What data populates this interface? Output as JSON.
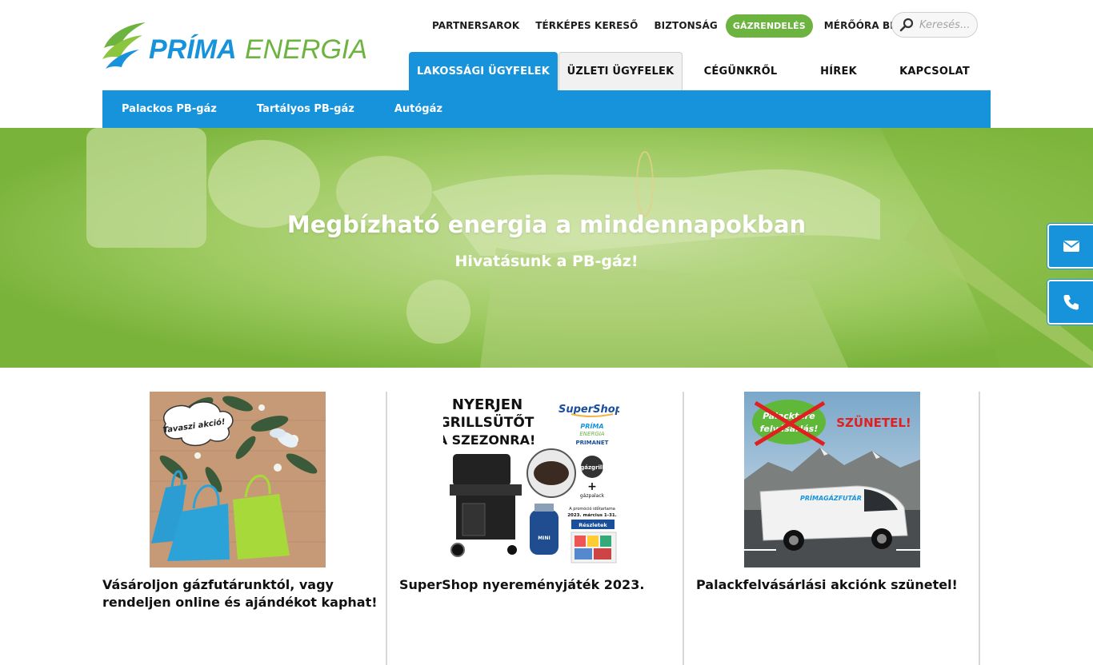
{
  "brand": {
    "logo_text_prima": "PRÍMA",
    "logo_text_energia": "ENERGIA",
    "green": "#6cb33f",
    "blue": "#1793dc"
  },
  "top_links": [
    {
      "label": "PARTNERSAROK"
    },
    {
      "label": "TÉRKÉPES KERESŐ"
    },
    {
      "label": "BIZTONSÁG"
    },
    {
      "label": "GÁZRENDELÉS"
    },
    {
      "label": "MÉRŐÓRA BEJELENTÉS"
    }
  ],
  "search": {
    "placeholder": "Keresés...",
    "icon": "search-icon"
  },
  "main_nav": [
    {
      "label": "LAKOSSÁGI ÜGYFELEK",
      "state": "active"
    },
    {
      "label": "ÜZLETI ÜGYFELEK",
      "state": "boxed"
    },
    {
      "label": "CÉGÜNKRŐL"
    },
    {
      "label": "HÍREK"
    },
    {
      "label": "KAPCSOLAT"
    }
  ],
  "sub_nav": [
    {
      "label": "Palackos PB-gáz"
    },
    {
      "label": "Tartályos PB-gáz"
    },
    {
      "label": "Autógáz"
    }
  ],
  "hero": {
    "title": "Megbízható energia a mindennapokban",
    "subtitle": "Hivatásunk a PB-gáz!"
  },
  "floating": {
    "mail_icon": "envelope-icon",
    "phone_icon": "phone-icon"
  },
  "cards": [
    {
      "caption": "Vásároljon gázfutárunktól, vagy rendeljen online és ajándékot kaphat!",
      "image_text": "Tavaszi akció!"
    },
    {
      "caption": "SuperShop nyereményjáték 2023.",
      "image_text": {
        "headline1": "NYERJEN",
        "headline2": "GRILLSÜTŐT",
        "headline3": "A SZEZONRA!",
        "supershop": "SuperShop",
        "prima": "PRÍMA",
        "energia": "ENERGIA",
        "primanet": "PRIMANET",
        "gazgrill": "gázgrill",
        "plus": "+",
        "gazpalack": "gázpalack",
        "promo": "A promóció időtartama",
        "dates": "2023. március 1-31.",
        "details": "Részletek"
      }
    },
    {
      "caption": "Palackfelvásárlási akciónk szünetel!",
      "image_text": {
        "bubble1": "Palacktere",
        "bubble2": "felvásárlás!",
        "stamp": "SZÜNETEL!",
        "van": "PRÍMAGÁZFUTÁR"
      }
    }
  ]
}
